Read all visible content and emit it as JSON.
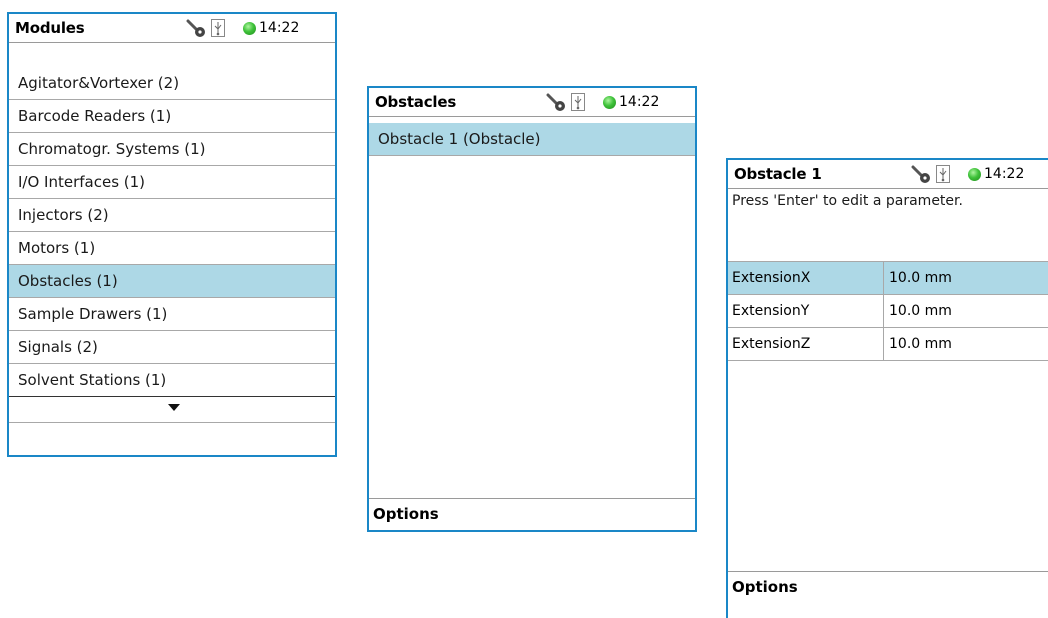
{
  "status": {
    "time": "14:22",
    "key_icon": "wrench-key-icon",
    "usb_icon": "usb-icon",
    "led_color": "#3fc23a"
  },
  "modules": {
    "title": "Modules",
    "items": [
      {
        "label": "Agitator&Vortexer (2)",
        "selected": false
      },
      {
        "label": "Barcode Readers (1)",
        "selected": false
      },
      {
        "label": "Chromatogr. Systems (1)",
        "selected": false
      },
      {
        "label": "I/O Interfaces (1)",
        "selected": false
      },
      {
        "label": "Injectors (2)",
        "selected": false
      },
      {
        "label": "Motors (1)",
        "selected": false
      },
      {
        "label": "Obstacles (1)",
        "selected": true
      },
      {
        "label": "Sample Drawers (1)",
        "selected": false
      },
      {
        "label": "Signals (2)",
        "selected": false
      },
      {
        "label": "Solvent Stations (1)",
        "selected": false
      }
    ]
  },
  "obstacles": {
    "title": "Obstacles",
    "items": [
      {
        "label": "Obstacle 1 (Obstacle)",
        "selected": true
      }
    ],
    "footer": "Options"
  },
  "obstacle1": {
    "title": "Obstacle 1",
    "hint": "Press 'Enter' to edit a parameter.",
    "params": [
      {
        "name": "ExtensionX",
        "value": "10.0 mm",
        "selected": true
      },
      {
        "name": "ExtensionY",
        "value": "10.0 mm",
        "selected": false
      },
      {
        "name": "ExtensionZ",
        "value": "10.0 mm",
        "selected": false
      }
    ],
    "footer": "Options"
  },
  "colors": {
    "border": "#1a87c7",
    "selection": "#add8e6"
  }
}
